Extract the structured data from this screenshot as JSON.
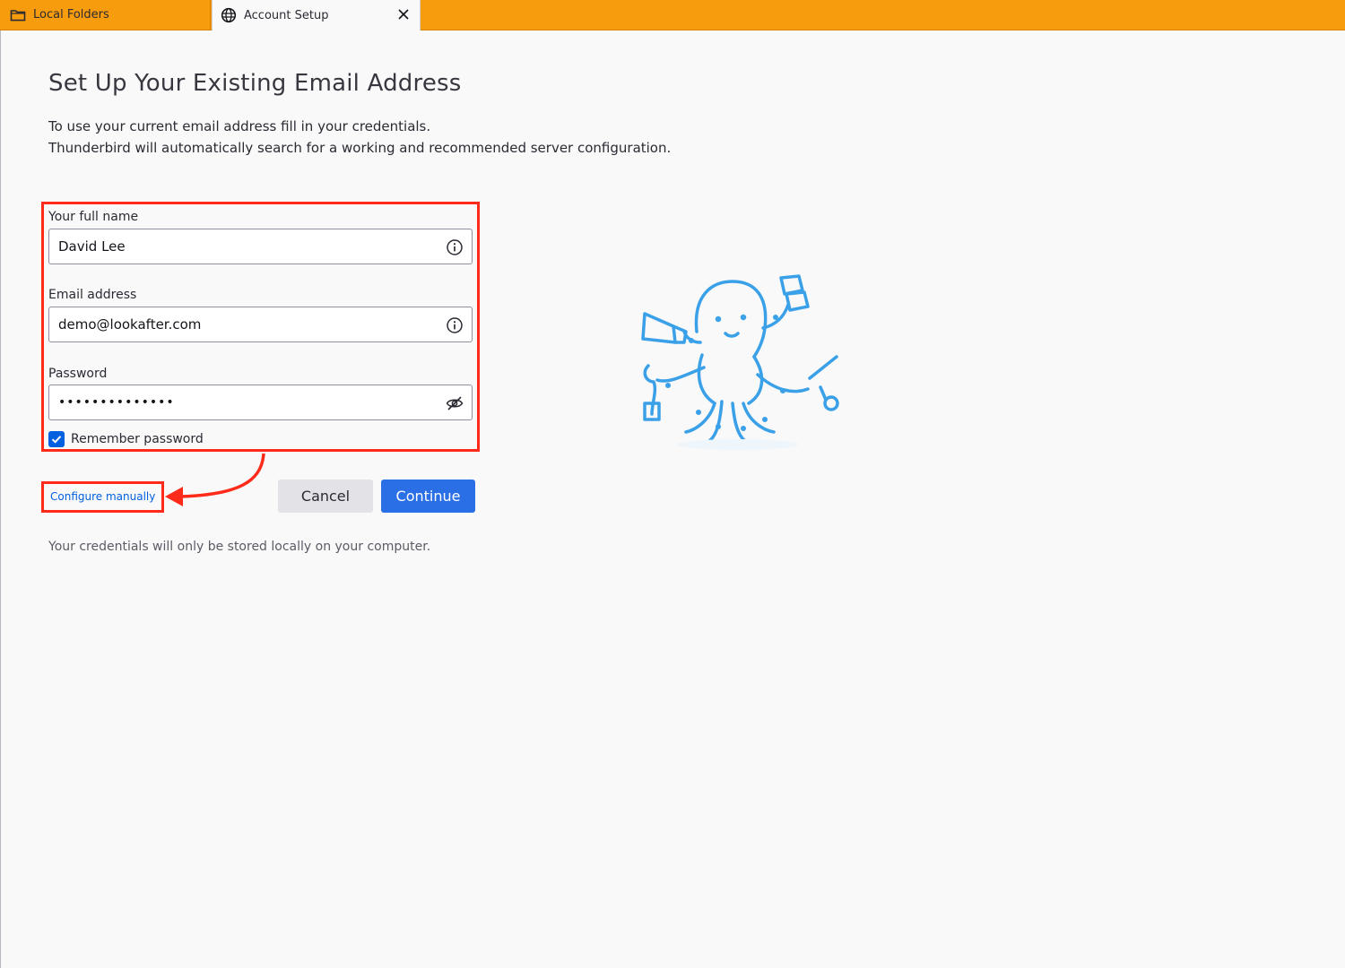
{
  "tabs": {
    "local_folders": {
      "label": "Local Folders",
      "icon": "folder-icon"
    },
    "account_setup": {
      "label": "Account Setup",
      "icon": "globe-icon",
      "close_icon": "close-icon"
    }
  },
  "page": {
    "title": "Set Up Your Existing Email Address",
    "description_line1": "To use your current email address fill in your credentials.",
    "description_line2": "Thunderbird will automatically search for a working and recommended server configuration."
  },
  "form": {
    "full_name": {
      "label": "Your full name",
      "value": "David Lee",
      "icon": "info-icon"
    },
    "email": {
      "label": "Email address",
      "value": "demo@lookafter.com",
      "icon": "info-icon"
    },
    "password": {
      "label": "Password",
      "value": "••••••••••••••",
      "icon": "eye-slash-icon"
    },
    "remember_password": {
      "label": "Remember password",
      "checked": true
    }
  },
  "actions": {
    "configure_manually": "Configure manually",
    "cancel": "Cancel",
    "continue": "Continue"
  },
  "footer_note": "Your credentials will only be stored locally on your computer.",
  "colors": {
    "tabbar": "#f79c0d",
    "accent_blue": "#2a6fe6",
    "link_blue": "#0060df",
    "highlight_red": "#ff2b1a",
    "mascot_blue": "#3aa0e8"
  }
}
